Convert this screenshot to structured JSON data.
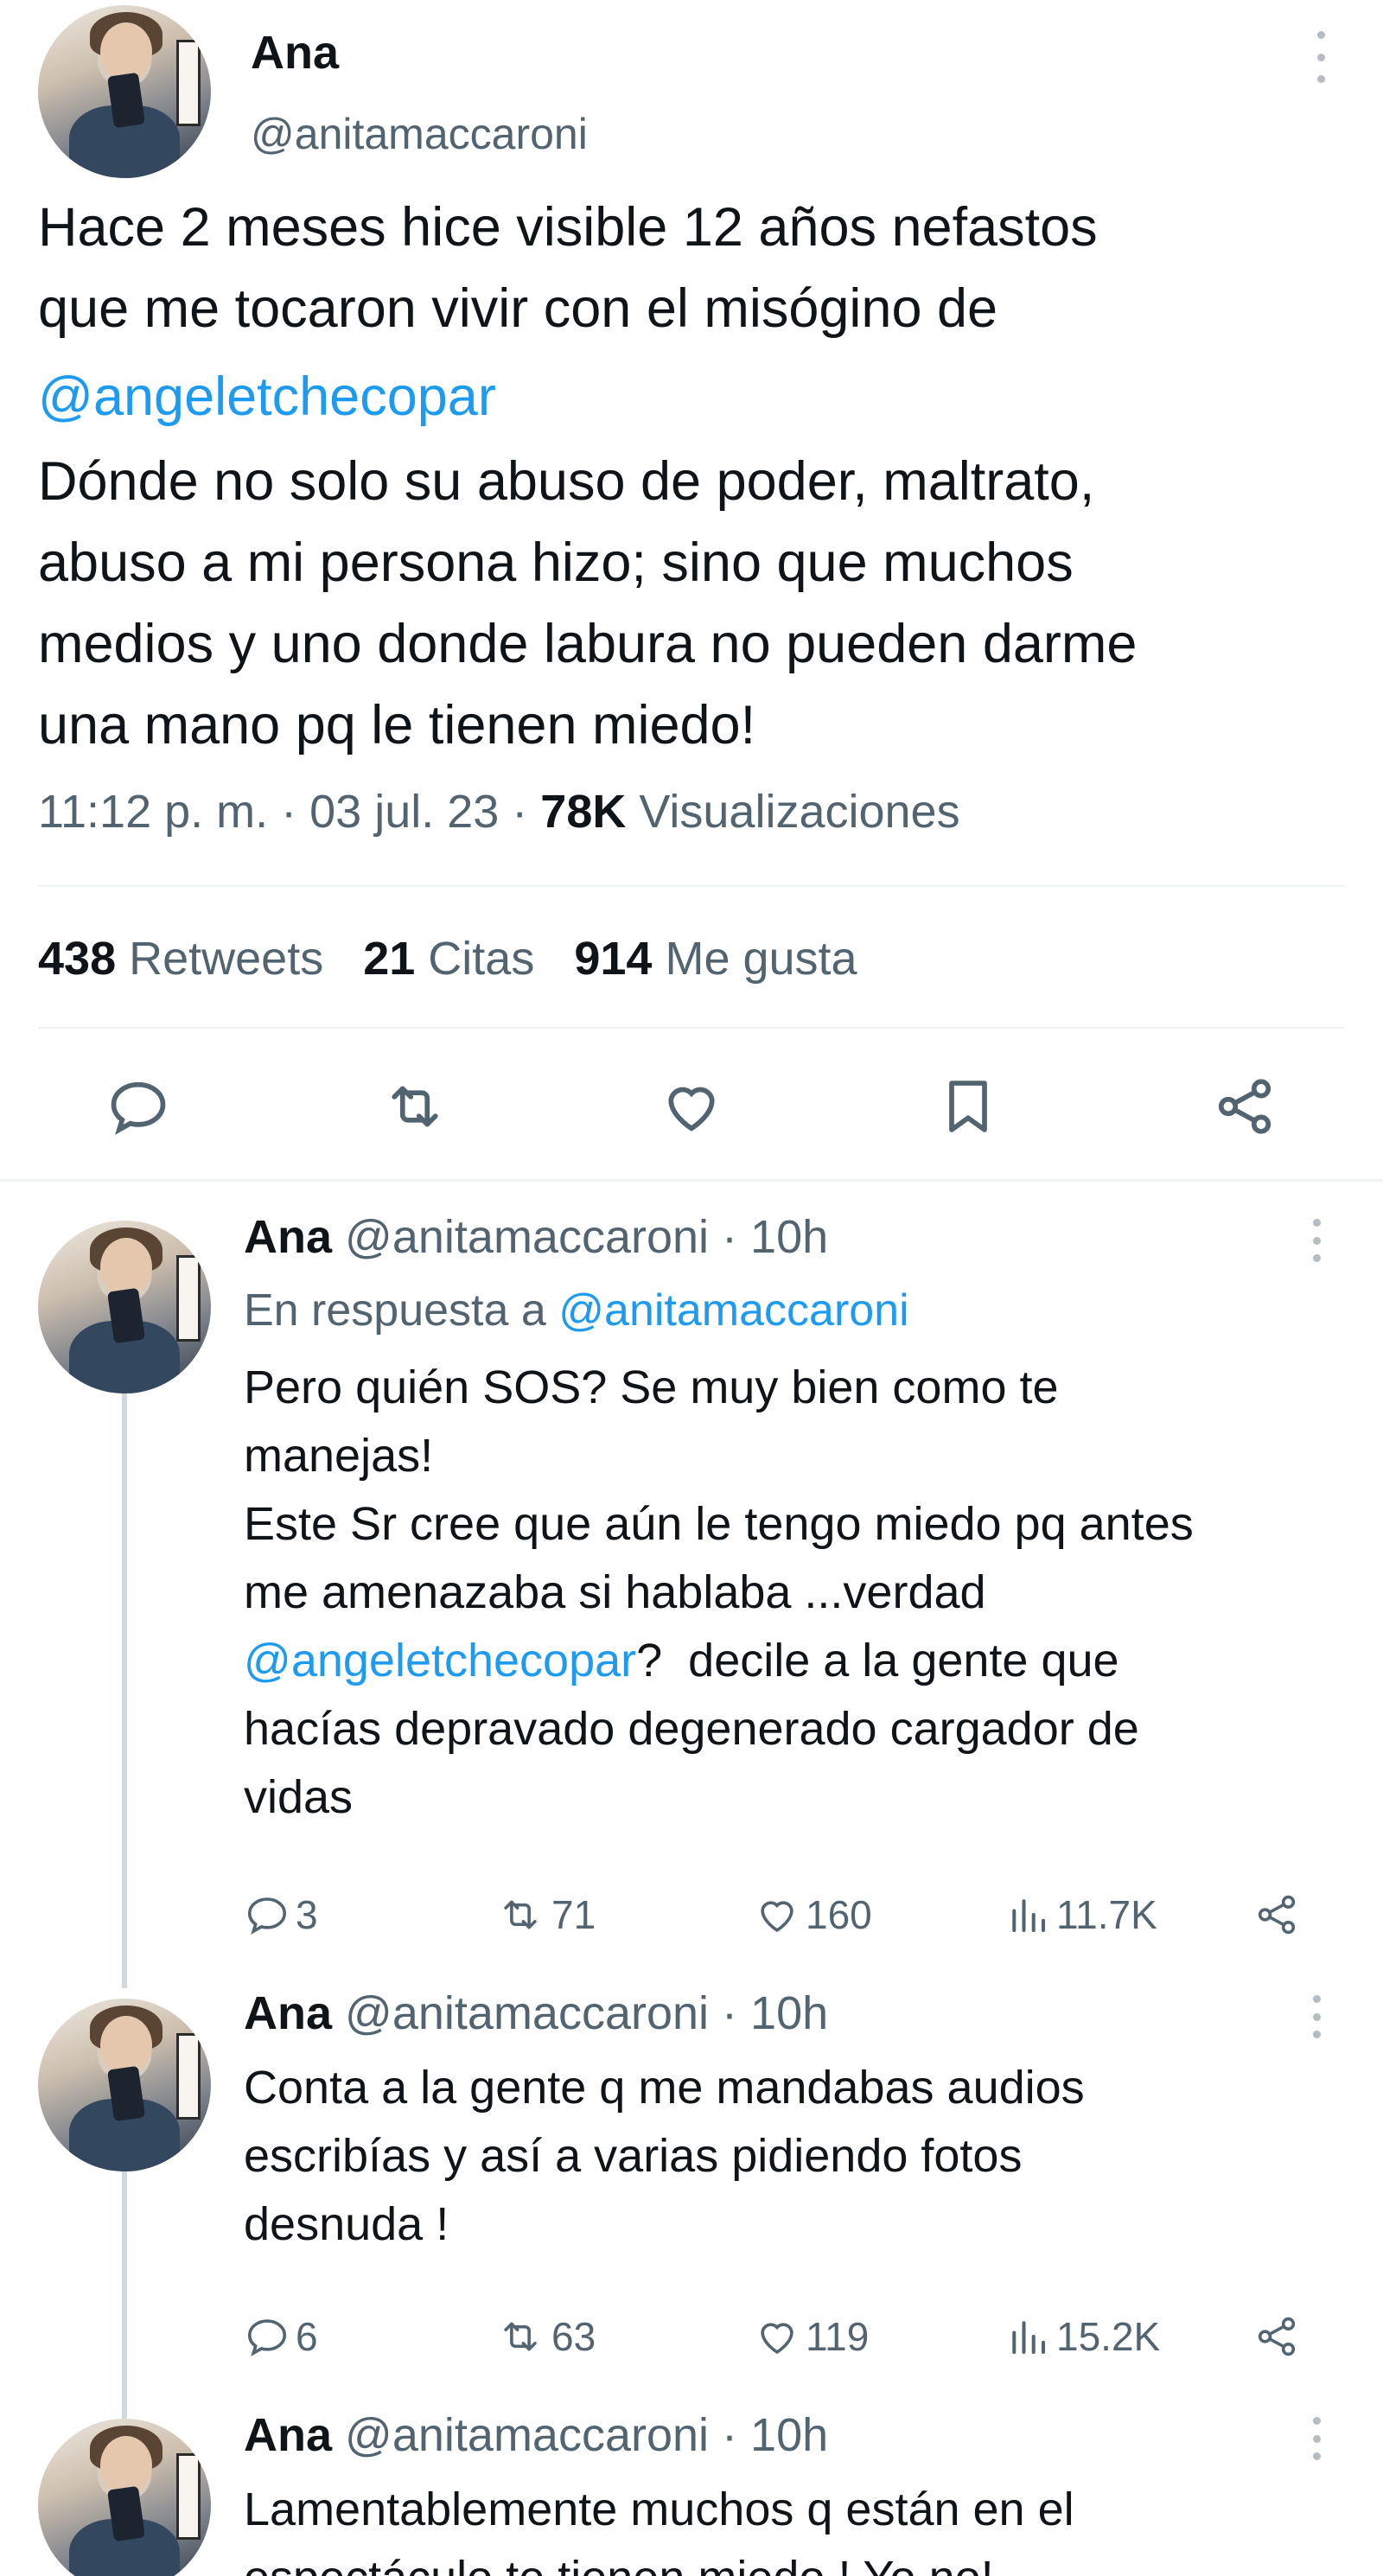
{
  "main_tweet": {
    "author_name": "Ana",
    "author_handle": "@anitamaccaroni",
    "text_line1": "Hace 2 meses hice visible 12 años nefastos",
    "text_line2": "que me tocaron vivir con el misógino de",
    "mention": "@angeletchecopar",
    "text_rest": "Dónde no solo su abuso de poder, maltrato,\nabuso a mi persona hizo; sino que muchos\nmedios y uno donde labura no pueden darme\nuna mano pq le tienen miedo!",
    "time": "11:12 p. m. · 03 jul. 23 · ",
    "views_count": "78K",
    "views_label": " Visualizaciones",
    "retweets_count": "438",
    "retweets_label": " Retweets",
    "quotes_count": "21",
    "quotes_label": " Citas",
    "likes_count": "914",
    "likes_label": " Me gusta",
    "actions": [
      "reply-icon",
      "retweet-icon",
      "like-icon",
      "bookmark-icon",
      "share-icon"
    ]
  },
  "replies": [
    {
      "name": "Ana",
      "handle": "@anitamaccaroni",
      "time": " · 10h",
      "reply_to_label": "En respuesta a ",
      "reply_to_handle": "@anitamaccaroni",
      "text_a": "Pero quién SOS? Se muy bien como te\nmanejas!\nEste Sr cree que aún le tengo miedo pq antes\nme amenazaba si hablaba ...verdad",
      "mention": "@angeletchecopar",
      "text_b": "?  decile a la gente que",
      "text_c": "hacías depravado degenerado cargador de\nvidas",
      "replies": "3",
      "retweets": "71",
      "likes": "160",
      "views": "11.7K"
    },
    {
      "name": "Ana",
      "handle": "@anitamaccaroni",
      "time": " · 10h",
      "text": "Conta a la gente q me mandabas audios\nescribías y así a varias pidiendo fotos\ndesnuda !",
      "replies": "6",
      "retweets": "63",
      "likes": "119",
      "views": "15.2K"
    },
    {
      "name": "Ana",
      "handle": "@anitamaccaroni",
      "time": " · 10h",
      "text": "Lamentablemente muchos q están en el",
      "text_cut": "espectáculo te tienen miedo ! Yo no!"
    }
  ],
  "colors": {
    "link": "#1d9bf0",
    "secondary_text": "#536471",
    "primary_text": "#0f1419",
    "icon": "#536471",
    "divider": "#eff3f4"
  }
}
